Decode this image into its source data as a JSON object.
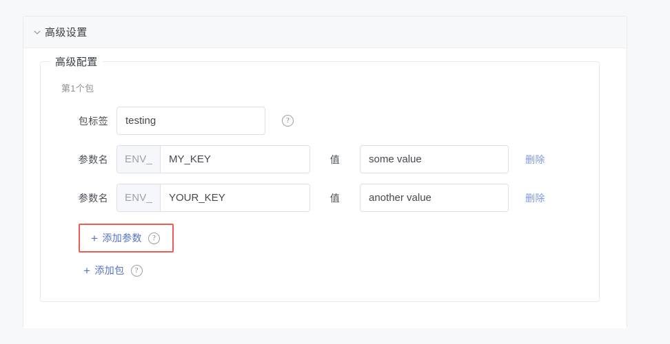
{
  "page": {
    "background_color": "#f7f8fa"
  },
  "collapse": {
    "title": "高级设置",
    "chevron_icon": "chevron-down-icon",
    "expanded": true
  },
  "fieldset": {
    "legend": "高级配置",
    "package_index_label": "第1个包"
  },
  "fields": {
    "tag": {
      "label": "包标签",
      "value": "testing",
      "placeholder": "",
      "help_icon": "question-circle-icon"
    },
    "value_label": "值",
    "param_label": "参数名",
    "prefix": "ENV_",
    "params": [
      {
        "label": "参数名",
        "prefix": "ENV_",
        "key": "MY_KEY",
        "value_label": "值",
        "value": "some value",
        "delete_label": "删除"
      },
      {
        "label": "参数名",
        "prefix": "ENV_",
        "key": "YOUR_KEY",
        "value_label": "值",
        "value": "another value",
        "delete_label": "删除"
      }
    ]
  },
  "actions": {
    "add_param": {
      "label": "添加参数",
      "plus_icon": "plus-icon",
      "help_icon": "question-circle-icon",
      "highlight_color": "#f05a4f",
      "highlighted": true
    },
    "add_package": {
      "label": "添加包",
      "plus_icon": "plus-icon",
      "help_icon": "question-circle-icon"
    }
  },
  "colors": {
    "link": "#5570c6",
    "delete_link": "#7f96d8",
    "highlight": "#f05a4f",
    "border": "#dcdfe6",
    "header_bg": "#f7f8fa"
  }
}
